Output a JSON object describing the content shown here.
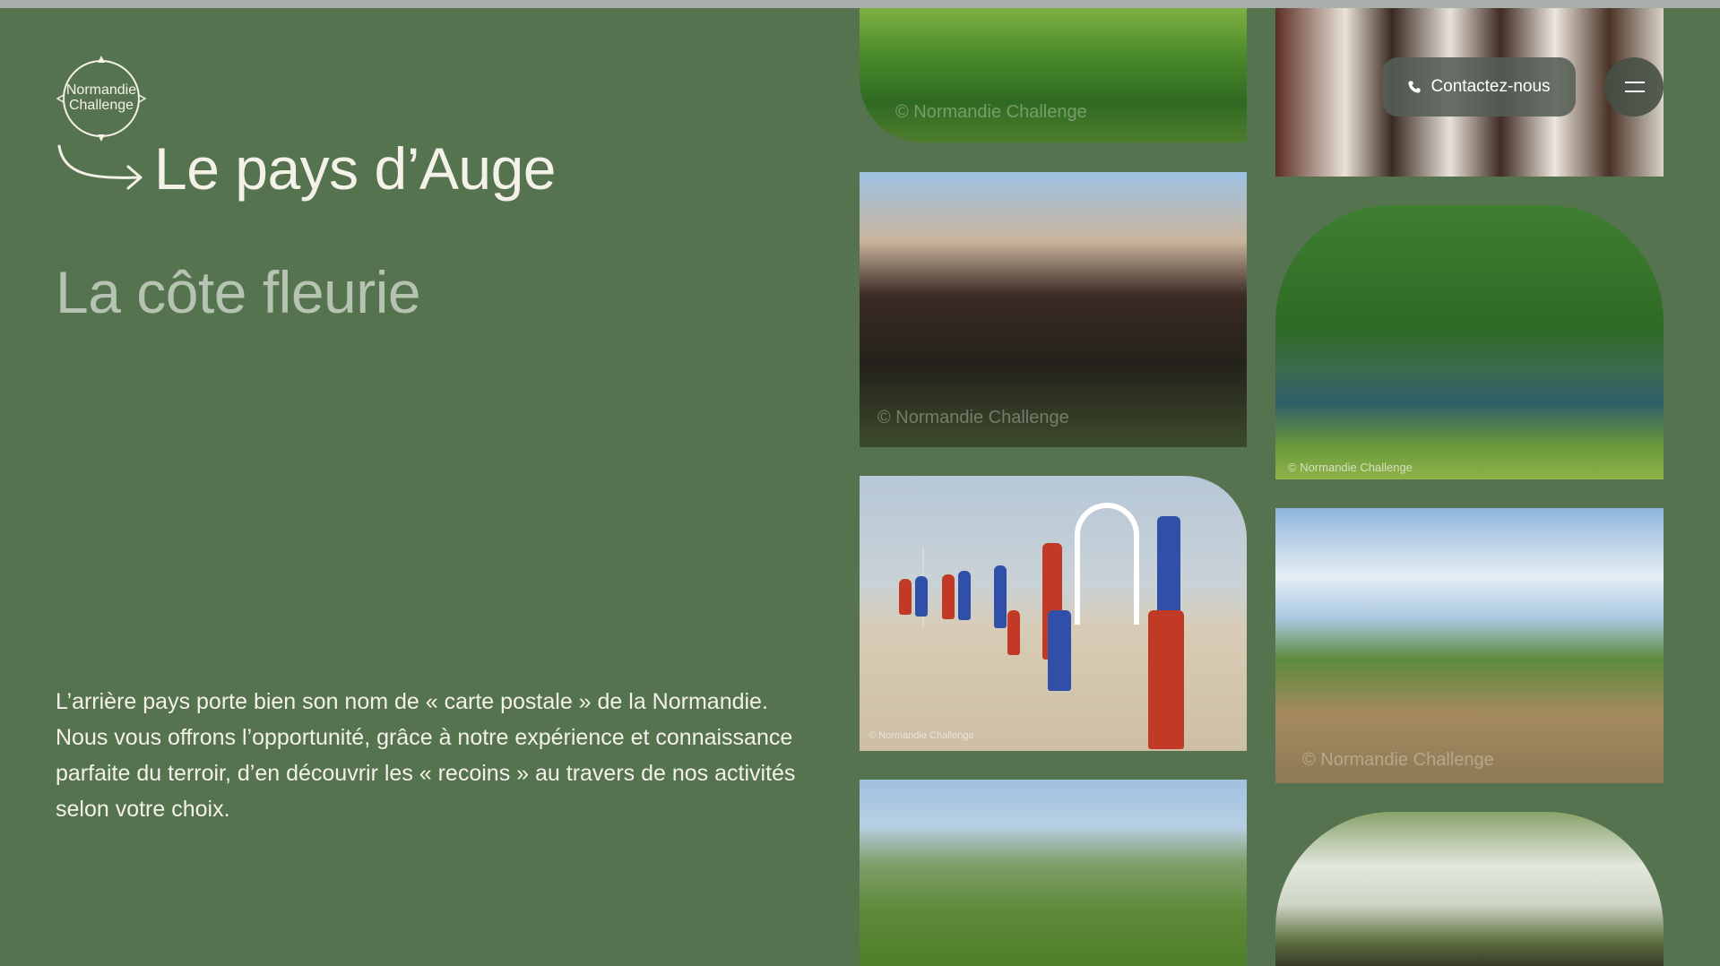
{
  "brand": {
    "logo_line1": "Normandie",
    "logo_line2": "Challenge"
  },
  "header": {
    "contact_label": "Contactez-nous",
    "phone_icon": "phone-icon",
    "menu_icon": "hamburger-menu-icon"
  },
  "main": {
    "title": "Le pays d’Auge",
    "subtitle": "La côte fleurie",
    "description": "L’arrière pays porte bien son nom de « carte postale » de la Normandie. Nous vous offrons l’opportunité, grâce à notre expérience et connaissance parfaite du terroir, d’en découvrir les « recoins » au travers de nos activités selon votre choix."
  },
  "gallery": {
    "credit": "© Normandie Challenge"
  },
  "colors": {
    "background": "#56734f",
    "text": "#f4f1e8",
    "subtitle": "#b7c3b2",
    "button": "#555f55"
  }
}
